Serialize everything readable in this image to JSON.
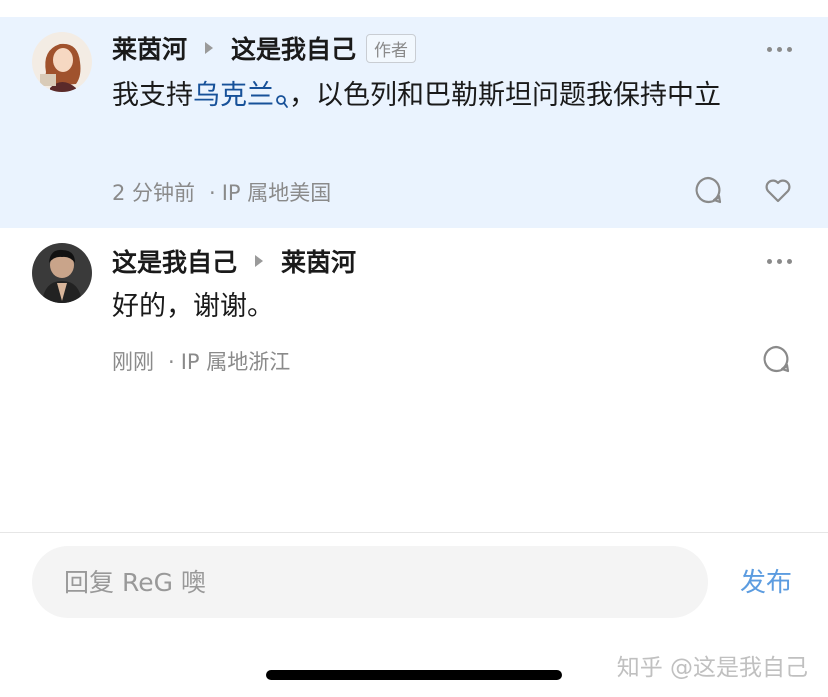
{
  "comments": [
    {
      "author": "莱茵河",
      "reply_to": "这是我自己",
      "tag": "作者",
      "content_before": "我支持",
      "content_link": "乌克兰",
      "content_after": "，以色列和巴勒斯坦问题我保持中立",
      "time": "2 分钟前",
      "location": "IP 属地美国",
      "highlighted": true,
      "icons": [
        "more-icon",
        "comment-icon",
        "heart-icon"
      ]
    },
    {
      "author": "这是我自己",
      "reply_to": "莱茵河",
      "content": "好的，谢谢。",
      "time": "刚刚",
      "location": "IP 属地浙江",
      "highlighted": false,
      "icons": [
        "more-icon",
        "comment-icon"
      ]
    }
  ],
  "reply_bar": {
    "placeholder": "回复 ReG 噢",
    "publish_label": "发布"
  },
  "watermark": "知乎 @这是我自己",
  "colors": {
    "highlight_bg": "#eaf3fe",
    "link": "#175199",
    "publish": "#5c9ce0",
    "meta": "#8a8a8a"
  }
}
